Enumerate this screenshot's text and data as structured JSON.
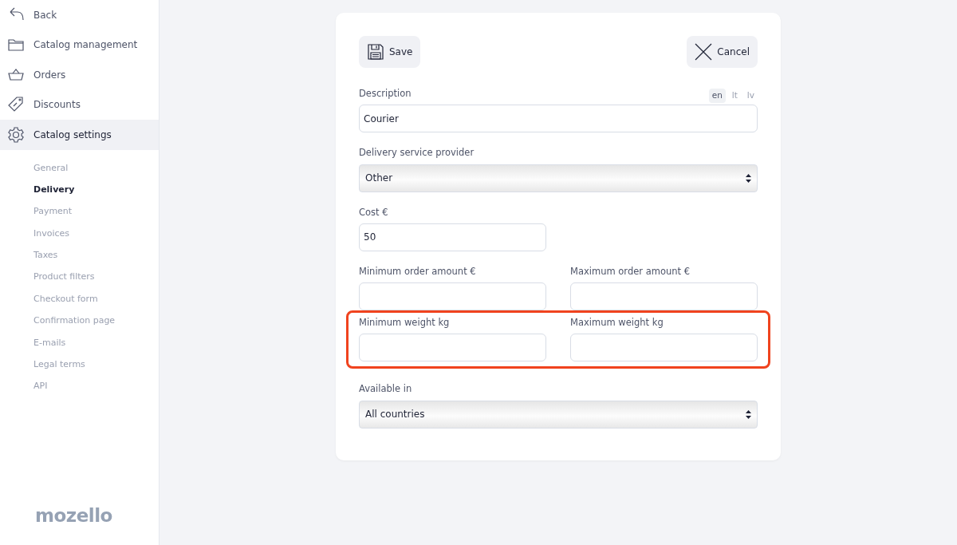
{
  "sidebar": {
    "nav": [
      {
        "label": "Back",
        "kind": "back",
        "selected": false
      },
      {
        "label": "Catalog management",
        "kind": "catalog",
        "selected": false
      },
      {
        "label": "Orders",
        "kind": "orders",
        "selected": false
      },
      {
        "label": "Discounts",
        "kind": "discounts",
        "selected": false
      },
      {
        "label": "Catalog settings",
        "kind": "settings",
        "selected": true
      }
    ],
    "subnav": [
      {
        "label": "General",
        "selected": false
      },
      {
        "label": "Delivery",
        "selected": true
      },
      {
        "label": "Payment",
        "selected": false
      },
      {
        "label": "Invoices",
        "selected": false
      },
      {
        "label": "Taxes",
        "selected": false
      },
      {
        "label": "Product filters",
        "selected": false
      },
      {
        "label": "Checkout form",
        "selected": false
      },
      {
        "label": "Confirmation page",
        "selected": false
      },
      {
        "label": "E-mails",
        "selected": false
      },
      {
        "label": "Legal terms",
        "selected": false
      },
      {
        "label": "API",
        "selected": false
      }
    ],
    "logo": "mozello"
  },
  "toolbar": {
    "save": "Save",
    "cancel": "Cancel"
  },
  "form": {
    "rows": [
      {
        "kind": "full",
        "highlighted": false,
        "languages": [
          {
            "code": "en",
            "selected": true
          },
          {
            "code": "lt",
            "selected": false
          },
          {
            "code": "lv",
            "selected": false
          }
        ],
        "fields": [
          {
            "kind": "text",
            "label": "Description",
            "value": "Courier"
          }
        ]
      },
      {
        "kind": "full",
        "highlighted": false,
        "fields": [
          {
            "kind": "select",
            "label": "Delivery service provider",
            "value": "Other"
          }
        ]
      },
      {
        "kind": "half",
        "highlighted": false,
        "fields": [
          {
            "kind": "text",
            "label": "Cost €",
            "value": "50"
          }
        ]
      },
      {
        "kind": "half",
        "highlighted": false,
        "fields": [
          {
            "kind": "text",
            "label": "Minimum order amount €"
          },
          {
            "kind": "text",
            "label": "Maximum order amount €"
          }
        ]
      },
      {
        "kind": "half",
        "highlighted": true,
        "fields": [
          {
            "kind": "text",
            "label": "Minimum weight kg"
          },
          {
            "kind": "text",
            "label": "Maximum weight kg"
          }
        ]
      },
      {
        "kind": "full",
        "highlighted": false,
        "fields": [
          {
            "kind": "select",
            "label": "Available in",
            "value": "All countries"
          }
        ]
      }
    ]
  }
}
